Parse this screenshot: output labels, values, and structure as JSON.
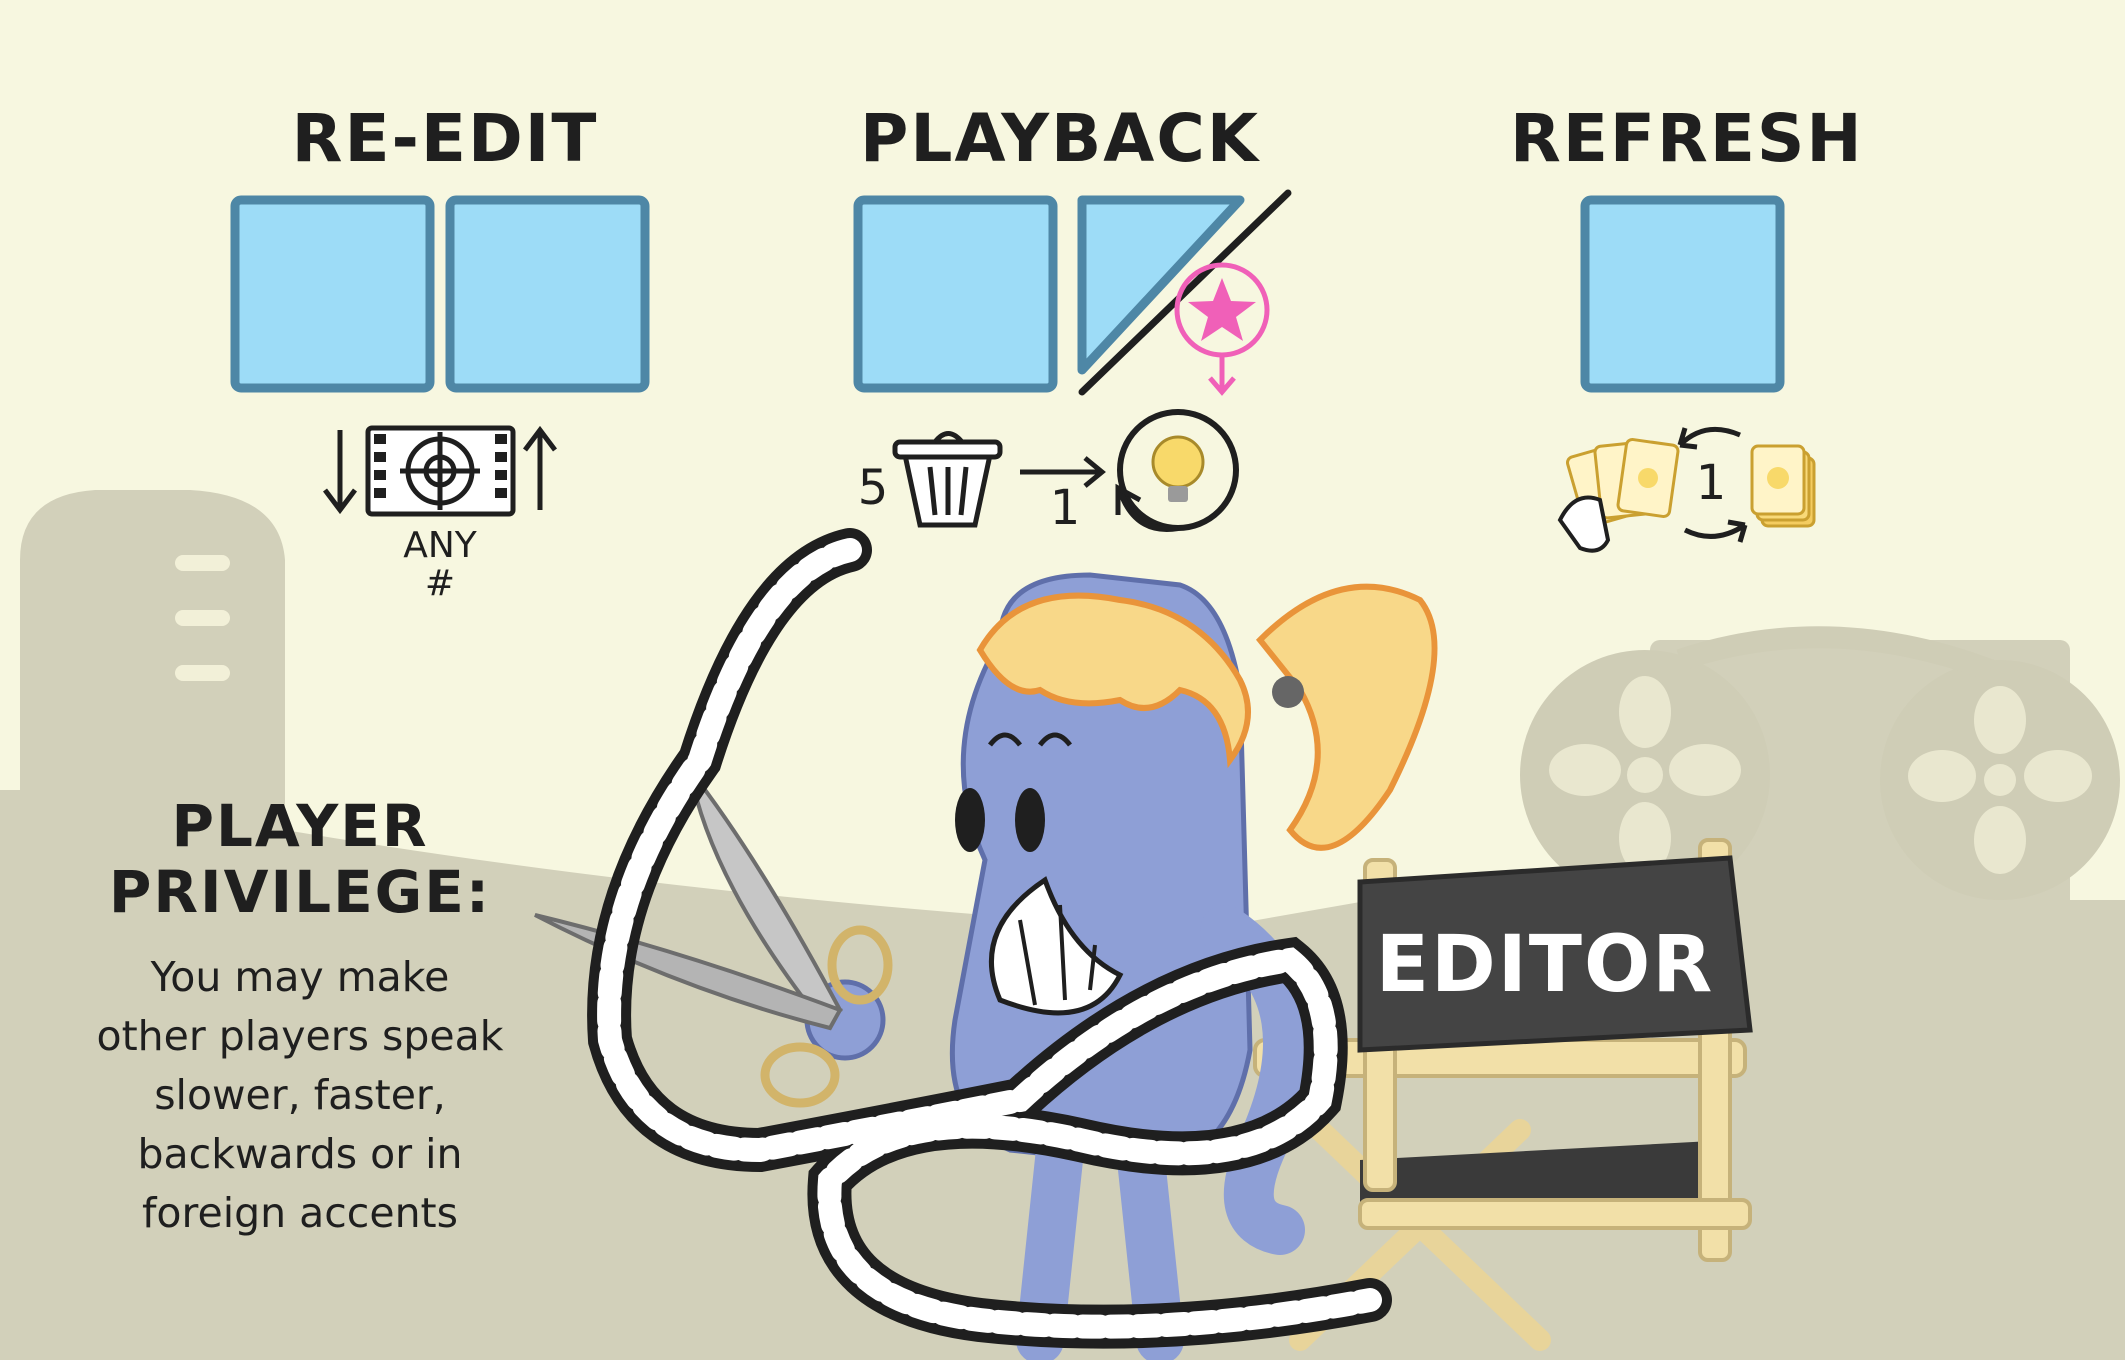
{
  "abilities": [
    {
      "name": "RE-EDIT",
      "note_line1": "ANY",
      "note_line2": "#"
    },
    {
      "name": "PLAYBACK",
      "discard_count": "5",
      "arrow_count": "1"
    },
    {
      "name": "REFRESH",
      "cycle_count": "1"
    }
  ],
  "privilege": {
    "heading_line1": "PLAYER",
    "heading_line2": "PRIVILEGE:",
    "text_lines": [
      "You may make",
      "other players speak",
      "slower, faster,",
      "backwards or in",
      "foreign accents"
    ]
  },
  "chair_label": "EDITOR",
  "colors": {
    "background": "#f7f7e0",
    "silhouette": "#cfcdb6",
    "slot_fill": "#9ddcf7",
    "slot_border": "#4e87a6",
    "character": "#8e9fd6",
    "hair": "#f8d889",
    "star": "#f060b8",
    "chair_frame": "#f2e0a8",
    "chair_seat": "#3a3a3a"
  },
  "icons": [
    "film-frame-icon",
    "trash-can-icon",
    "lightbulb-icon",
    "card-hand-icon",
    "card-deck-icon",
    "star-icon",
    "scissors-icon",
    "film-reel-icon"
  ]
}
